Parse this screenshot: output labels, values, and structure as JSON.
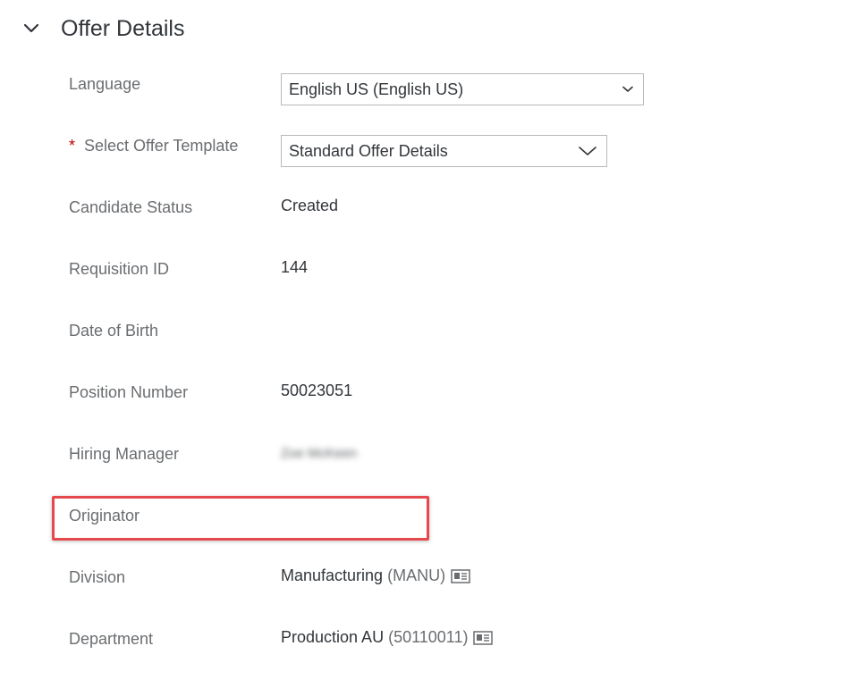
{
  "section": {
    "title": "Offer Details",
    "chevron_icon": "chevron-down-icon"
  },
  "fields": {
    "language": {
      "label": "Language",
      "value": "English US (English US)"
    },
    "offer_template": {
      "required_marker": "*",
      "label": "Select Offer Template",
      "value": "Standard Offer Details"
    },
    "candidate_status": {
      "label": "Candidate Status",
      "value": "Created"
    },
    "requisition_id": {
      "label": "Requisition ID",
      "value": "144"
    },
    "date_of_birth": {
      "label": "Date of Birth",
      "value": ""
    },
    "position_number": {
      "label": "Position Number",
      "value": "50023051"
    },
    "hiring_manager": {
      "label": "Hiring Manager",
      "value": "Zoe McKeen"
    },
    "originator": {
      "label": "Originator",
      "value": ""
    },
    "division": {
      "label": "Division",
      "name": "Manufacturing",
      "code": "(MANU)",
      "icon": "business-card-icon"
    },
    "department": {
      "label": "Department",
      "name": "Production AU",
      "code": "(50110011)",
      "icon": "business-card-icon"
    }
  },
  "colors": {
    "highlight": "#e5484d",
    "required": "#bb0000",
    "label": "#6a6d70",
    "text": "#32363a"
  }
}
